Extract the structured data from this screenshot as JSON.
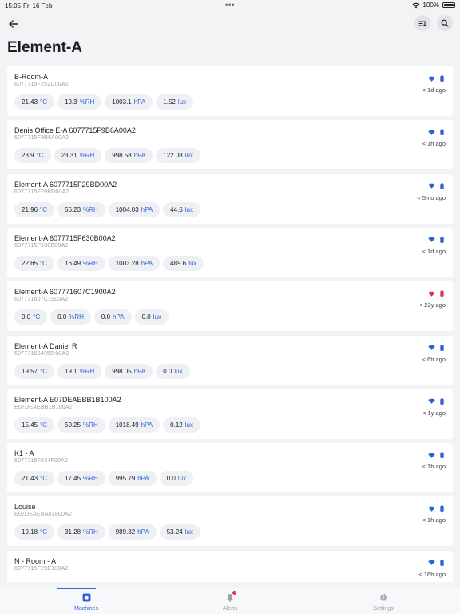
{
  "status_bar": {
    "time": "15:05",
    "date": "Fri 16 Feb",
    "battery": "100%",
    "dots": "•••"
  },
  "header": {
    "title": "Element-A"
  },
  "colors": {
    "accent": "#2f64d9",
    "ok": "#2f64d9",
    "error": "#e0384f"
  },
  "machines": [
    {
      "name": "B-Room-A",
      "serial": "6077715F252D00A2",
      "temp": "21.43",
      "hum": "19.3",
      "press": "1003.1",
      "light": "1.52",
      "status": "ok",
      "ago": "< 1d ago"
    },
    {
      "name": "Denis Office E-A 6077715F9B6A00A2",
      "serial": "6077715F9B6A00A2",
      "temp": "23.9",
      "hum": "23.31",
      "press": "998.58",
      "light": "122.08",
      "status": "ok",
      "ago": "< 1h ago"
    },
    {
      "name": "Element-A 6077715F29BD00A2",
      "serial": "6077715F29BD00A2",
      "temp": "21.96",
      "hum": "66.23",
      "press": "1004.03",
      "light": "44.6",
      "status": "ok",
      "ago": "< 5mo ago"
    },
    {
      "name": "Element-A 6077715F630B00A2",
      "serial": "6077715F630B00A2",
      "temp": "22.65",
      "hum": "16.49",
      "press": "1003.28",
      "light": "489.6",
      "status": "ok",
      "ago": "< 1d ago"
    },
    {
      "name": "Element-A 607771607C1900A2",
      "serial": "607771607C1900A2",
      "temp": "0.0",
      "hum": "0.0",
      "press": "0.0",
      "light": "0.0",
      "status": "error",
      "ago": "< 22y ago"
    },
    {
      "name": "Element-A Daniel R",
      "serial": "607771604950 00A2",
      "temp": "19.57",
      "hum": "19.1",
      "press": "998.05",
      "light": "0.0",
      "status": "ok",
      "ago": "< 6h ago"
    },
    {
      "name": "Element-A E07DEAEBB1B100A2",
      "serial": "E07DEAEBB1B100A2",
      "temp": "15.45",
      "hum": "50.25",
      "press": "1018.49",
      "light": "0.12",
      "status": "ok",
      "ago": "< 1y ago"
    },
    {
      "name": "K1 - A",
      "serial": "6077715F634F00A2",
      "temp": "21.43",
      "hum": "17.45",
      "press": "995.79",
      "light": "0.0",
      "status": "ok",
      "ago": "< 1h ago"
    },
    {
      "name": "Louise",
      "serial": "E07DEAEBA01800A2",
      "temp": "19.18",
      "hum": "31.28",
      "press": "989.32",
      "light": "53.24",
      "status": "ok",
      "ago": "< 1h ago"
    },
    {
      "name": "N - Room - A",
      "serial": "6077715F29E100A2",
      "temp": "",
      "hum": "",
      "press": "",
      "light": "",
      "status": "ok",
      "ago": "< 16h ago"
    }
  ],
  "units": {
    "temp": "°C",
    "hum": "%RH",
    "press": "hPA",
    "light": "lux"
  },
  "tabs": [
    {
      "label": "Machines",
      "icon": "machines-icon",
      "active": true
    },
    {
      "label": "Alerts",
      "icon": "bell-icon",
      "active": false
    },
    {
      "label": "Settings",
      "icon": "gear-icon",
      "active": false
    }
  ]
}
